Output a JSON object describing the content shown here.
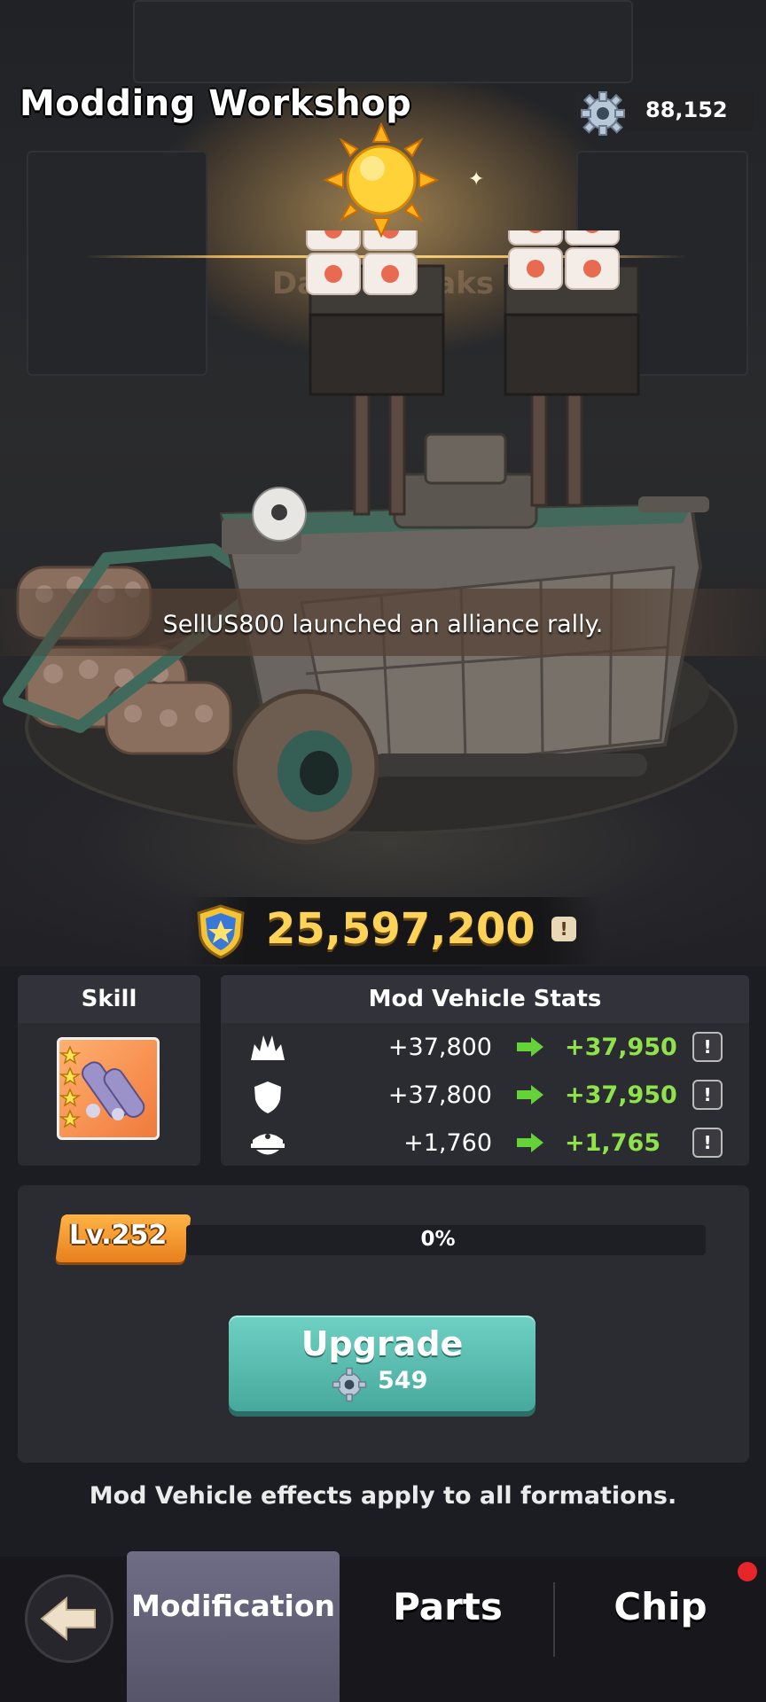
{
  "header": {
    "title": "Modding Workshop",
    "currency_value": "88,152",
    "currency_icon": "gear-icon"
  },
  "scene": {
    "event_banner": "Dawn Breaks",
    "event_icon": "sun-icon",
    "rally_message": "SellUS800 launched an alliance rally."
  },
  "power": {
    "value": "25,597,200",
    "icon": "shield-icon",
    "info_label": "!"
  },
  "skill": {
    "title": "Skill",
    "icon": "missile-skill-icon"
  },
  "stats": {
    "title": "Mod Vehicle Stats",
    "rows": [
      {
        "icon": "attack-icon",
        "current": "+37,800",
        "next": "+37,950",
        "info": "!"
      },
      {
        "icon": "defense-icon",
        "current": "+37,800",
        "next": "+37,950",
        "info": "!"
      },
      {
        "icon": "troop-icon",
        "current": "+1,760",
        "next": "+1,765",
        "info": "!"
      }
    ]
  },
  "level": {
    "label": "Lv.252",
    "progress_text": "0%",
    "progress": 0
  },
  "upgrade": {
    "label": "Upgrade",
    "cost": "549"
  },
  "footer_note": "Mod Vehicle effects apply to all formations.",
  "nav": {
    "tabs": [
      "Modification",
      "Parts",
      "Chip"
    ],
    "active": "Modification"
  },
  "colors": {
    "accent_green": "#8fe24a",
    "power_gold": "#ffd25a",
    "upgrade_teal": "#5cc0b3",
    "level_orange": "#f39a2e",
    "notification_red": "#e6262a"
  }
}
